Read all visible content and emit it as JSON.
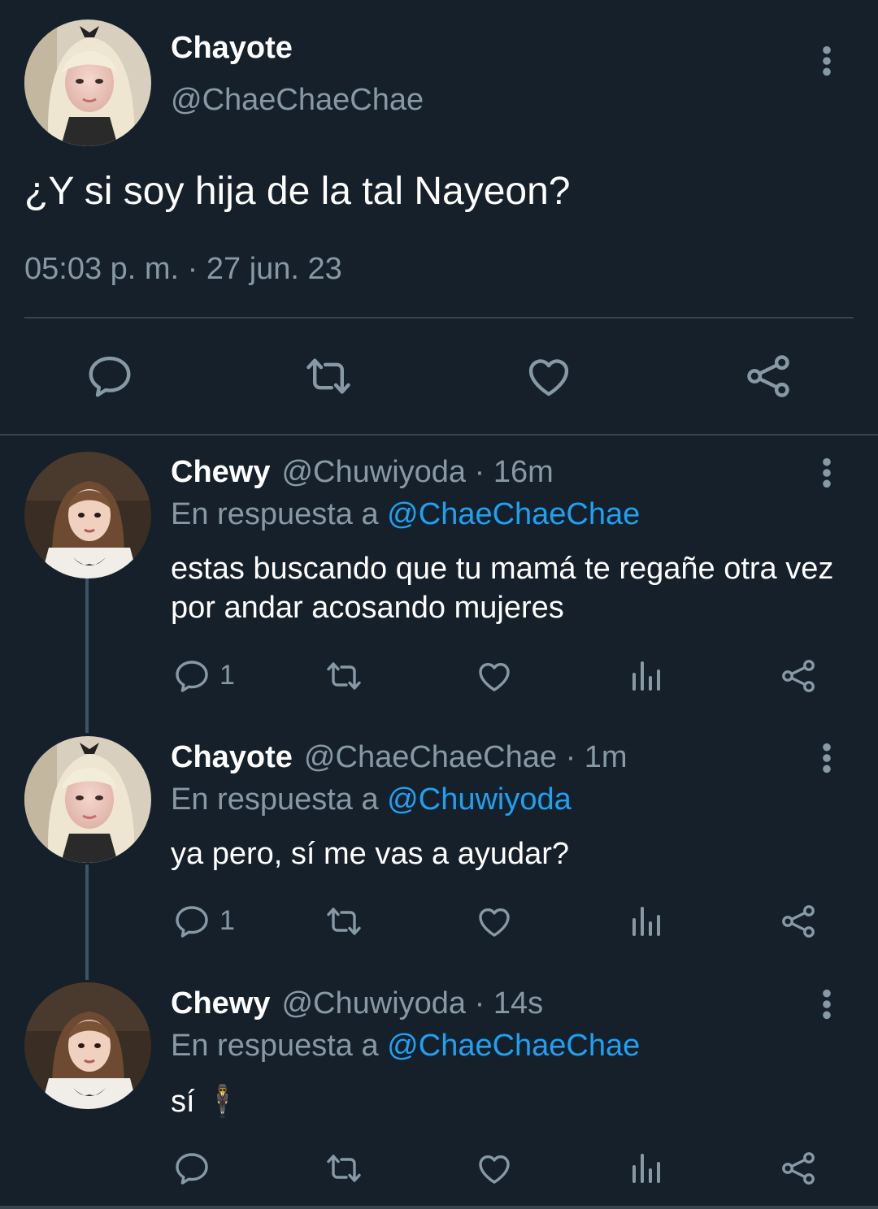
{
  "main_tweet": {
    "name": "Chayote",
    "handle": "@ChaeChaeChae",
    "text": "¿Y si soy hija de la tal Nayeon?",
    "timestamp": "05:03 p. m. · 27 jun. 23",
    "actions": [
      "reply-icon",
      "retweet-icon",
      "like-icon",
      "share-icon"
    ]
  },
  "replies": [
    {
      "name": "Chewy",
      "meta": "@Chuwiyoda · 16m",
      "replying_prefix": "En respuesta a ",
      "replying_to": "@ChaeChaeChae",
      "text": "estas buscando que tu mamá te regañe otra vez por andar acosando mujeres",
      "reply_count": "1"
    },
    {
      "name": "Chayote",
      "meta": "@ChaeChaeChae · 1m",
      "replying_prefix": "En respuesta a ",
      "replying_to": "@Chuwiyoda",
      "text": "ya pero, sí me vas a ayudar?",
      "reply_count": "1"
    },
    {
      "name": "Chewy",
      "meta": "@Chuwiyoda · 14s",
      "replying_prefix": "En respuesta a ",
      "replying_to": "@ChaeChaeChae",
      "text": "sí 🕴",
      "reply_count": ""
    }
  ],
  "colors": {
    "background": "#15202b",
    "secondary_text": "#8899a6",
    "link": "#1da1f2",
    "divider": "#38444d"
  }
}
